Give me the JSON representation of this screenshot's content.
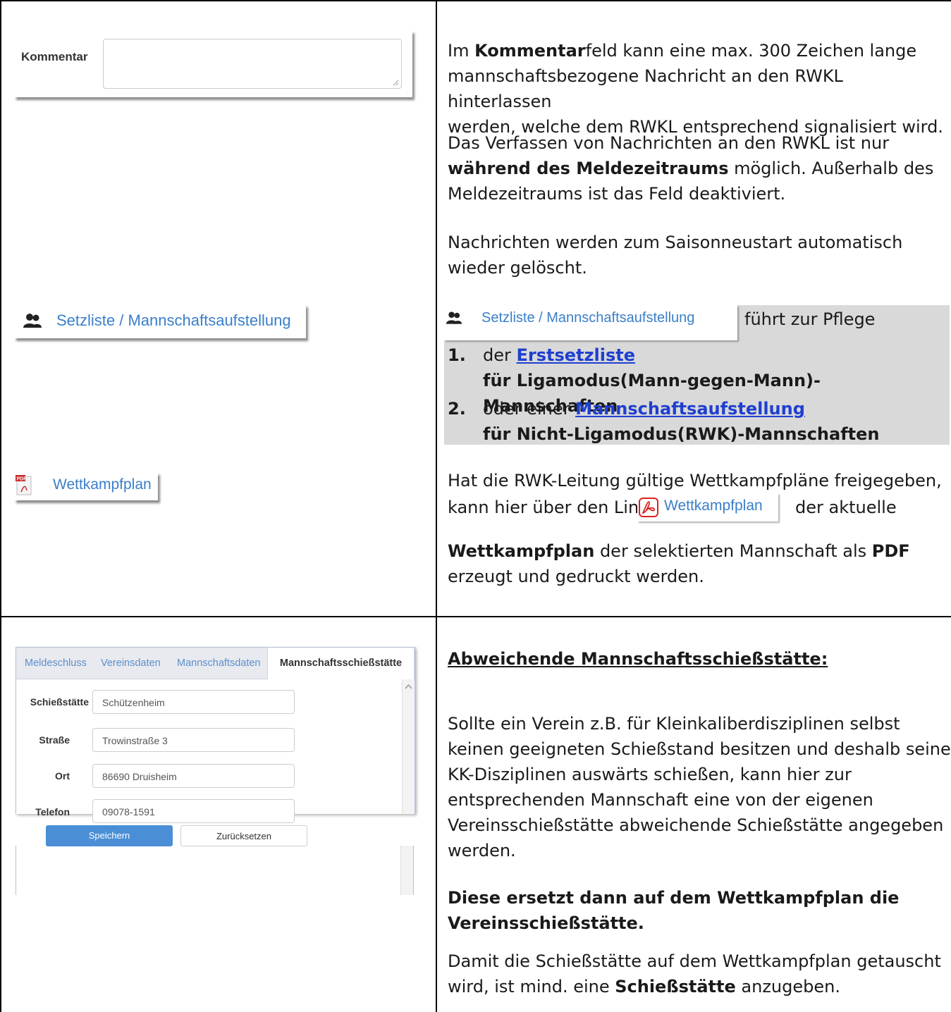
{
  "row1": {
    "kommentar_label": "Kommentar",
    "setzliste_link": "Setzliste / Mannschaftsaufstellung",
    "wettkampfplan_link": "Wettkampfplan",
    "para1": {
      "pre": "Im ",
      "bold": "Kommentar",
      "line1_rest": "feld kann eine max. 300 Zeichen lange",
      "line2": "mannschaftsbezogene Nachricht an den RWKL hinterlassen",
      "line3": "werden, welche dem RWKL entsprechend signalisiert wird."
    },
    "para2": {
      "line1": "Das Verfassen von Nachrichten an den RWKL ist nur",
      "bold": "während des Meldezeitraums",
      "line2_rest": " möglich. Außerhalb des",
      "line3": "Meldezeitraums ist das Feld deaktiviert."
    },
    "para3": {
      "line1": "Nachrichten werden zum Saisonneustart automatisch",
      "line2": "wieder gelöscht."
    },
    "setz_box": {
      "link": "Setzliste / Mannschaftsaufstellung",
      "after": "führt zur Pflege",
      "items": [
        {
          "num": "1.",
          "pre": "der ",
          "link": "Erstsetzliste",
          "sub": "für Ligamodus(Mann-gegen-Mann)-Mannschaften"
        },
        {
          "num": "2.",
          "pre": "oder einer ",
          "link": "Mannschaftsaufstellung",
          "sub": "für Nicht-Ligamodus(RWK)-Mannschaften"
        }
      ]
    },
    "para4": {
      "line1": "Hat die RWK-Leitung gültige Wettkampfpläne freigegeben,",
      "line2_pre": "kann hier über den Link",
      "link": "Wettkampfplan",
      "line2_post": "der aktuelle",
      "line3_bold1": "Wettkampfplan",
      "line3_mid": " der selektierten Mannschaft als ",
      "line3_bold2": "PDF",
      "line4": "erzeugt und gedruckt werden."
    }
  },
  "row2": {
    "tabs": [
      "Meldeschluss",
      "Vereinsdaten",
      "Mannschaftsdaten",
      "Mannschaftsschießstätte"
    ],
    "fields": [
      {
        "label": "Schießstätte",
        "value": "Schützenheim"
      },
      {
        "label": "Straße",
        "value": "Trowinstraße 3"
      },
      {
        "label": "Ort",
        "value": "86690 Druisheim"
      },
      {
        "label": "Telefon",
        "value": "09078-1591"
      }
    ],
    "save": "Speichern",
    "reset": "Zurücksetzen",
    "heading": "Abweichende Mannschaftsschießstätte:",
    "para1": [
      "Sollte ein Verein z.B. für Kleinkaliberdisziplinen selbst",
      "keinen geeigneten Schießstand besitzen und deshalb seine",
      "KK-Disziplinen auswärts schießen, kann hier zur",
      "entsprechenden Mannschaft eine von der eigenen",
      "Vereinsschießstätte abweichende Schießstätte angegeben",
      "werden."
    ],
    "para2": [
      "Diese ersetzt dann auf dem Wettkampfplan die",
      "Vereinsschießstätte."
    ],
    "para3": {
      "line1": "Damit die Schießstätte auf dem Wettkampfplan getauscht",
      "line2_pre": "wird, ist mind. eine ",
      "bold": "Schießstätte",
      "line2_post": " anzugeben."
    }
  }
}
